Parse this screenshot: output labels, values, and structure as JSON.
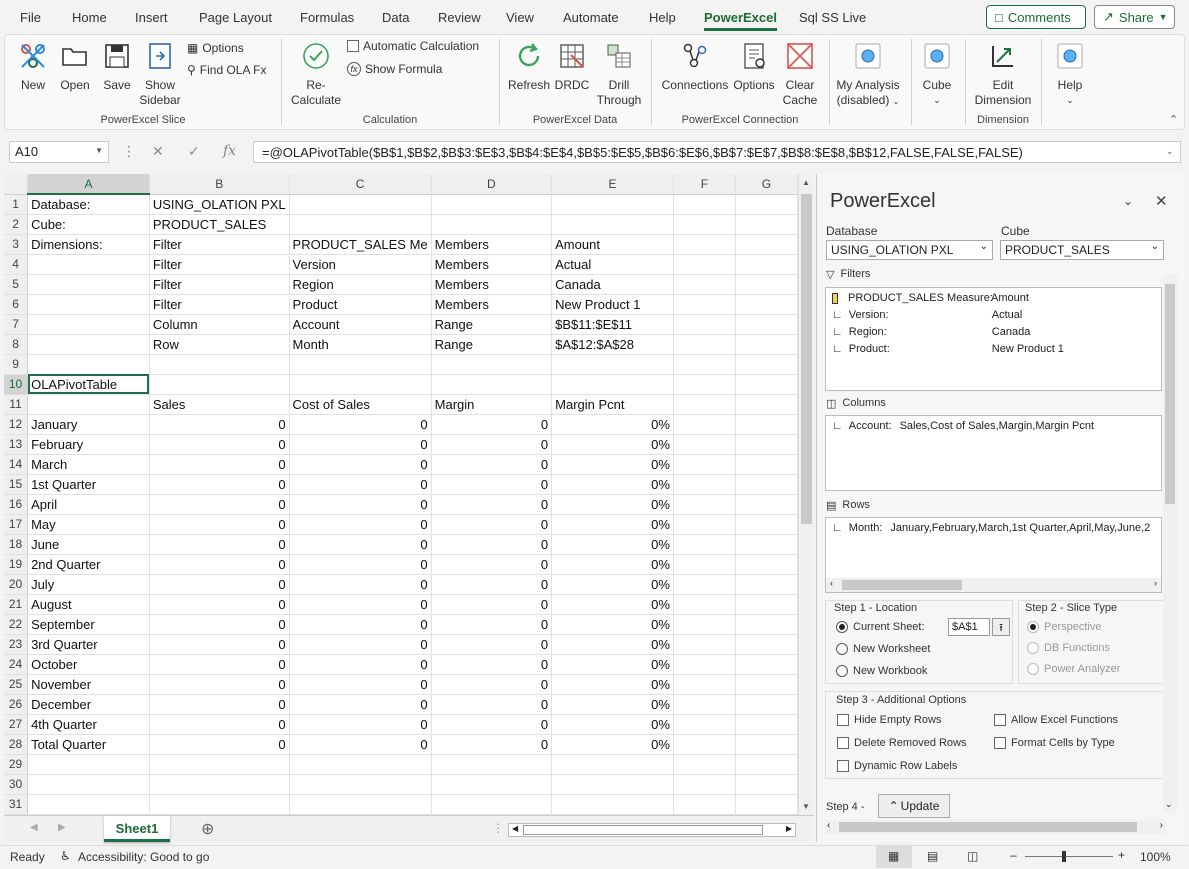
{
  "menu": {
    "tabs": [
      "File",
      "Home",
      "Insert",
      "Page Layout",
      "Formulas",
      "Data",
      "Review",
      "View",
      "Automate",
      "Help",
      "PowerExcel",
      "Sql SS Live"
    ],
    "active": "PowerExcel",
    "comments_label": "Comments",
    "share_label": "Share"
  },
  "ribbon": {
    "slice": {
      "new": "New",
      "open": "Open",
      "save": "Save",
      "show_sidebar_1": "Show",
      "show_sidebar_2": "Sidebar",
      "options": "Options",
      "find_ola_fx": "Find OLA Fx",
      "group": "PowerExcel Slice"
    },
    "calculation": {
      "recalc_1": "Re-",
      "recalc_2": "Calculate",
      "auto_calc": "Automatic Calculation",
      "show_formula": "Show Formula",
      "group": "Calculation"
    },
    "data": {
      "refresh": "Refresh",
      "drdc": "DRDC",
      "drill_1": "Drill",
      "drill_2": "Through",
      "group": "PowerExcel Data"
    },
    "connection": {
      "connections": "Connections",
      "options": "Options",
      "clear_1": "Clear",
      "clear_2": "Cache",
      "group": "PowerExcel Connection"
    },
    "analysis": {
      "label_1": "My Analysis",
      "label_2": "(disabled)"
    },
    "cube": {
      "label": "Cube"
    },
    "dimension": {
      "edit_1": "Edit",
      "edit_2": "Dimension",
      "group": "Dimension"
    },
    "help": {
      "label": "Help"
    }
  },
  "formula_bar": {
    "name_box": "A10",
    "formula": "=@OLAPivotTable($B$1,$B$2,$B$3:$E$3,$B$4:$E$4,$B$5:$E$5,$B$6:$E$6,$B$7:$E$7,$B$8:$E$8,$B$12,FALSE,FALSE,FALSE)"
  },
  "sheet": {
    "columns": [
      "A",
      "B",
      "C",
      "D",
      "E",
      "F",
      "G"
    ],
    "rows": [
      [
        "Database:",
        "USING_OLATION  PXL",
        "",
        "",
        ""
      ],
      [
        "Cube:",
        "PRODUCT_SALES",
        "",
        "",
        ""
      ],
      [
        "Dimensions:",
        "Filter",
        "PRODUCT_SALES Me",
        "Members",
        "Amount"
      ],
      [
        "",
        "Filter",
        "Version",
        "Members",
        "Actual"
      ],
      [
        "",
        "Filter",
        "Region",
        "Members",
        "Canada"
      ],
      [
        "",
        "Filter",
        "Product",
        "Members",
        "New Product 1"
      ],
      [
        "",
        "Column",
        "Account",
        "Range",
        "$B$11:$E$11"
      ],
      [
        "",
        "Row",
        "Month",
        "Range",
        "$A$12:$A$28"
      ],
      [
        "",
        "",
        "",
        "",
        ""
      ],
      [
        "OLAPivotTable",
        "",
        "",
        "",
        ""
      ],
      [
        "",
        "Sales",
        "Cost of Sales",
        "Margin",
        "Margin Pcnt"
      ],
      [
        "January",
        "0",
        "0",
        "0",
        "0%"
      ],
      [
        "February",
        "0",
        "0",
        "0",
        "0%"
      ],
      [
        "March",
        "0",
        "0",
        "0",
        "0%"
      ],
      [
        "1st Quarter",
        "0",
        "0",
        "0",
        "0%"
      ],
      [
        "April",
        "0",
        "0",
        "0",
        "0%"
      ],
      [
        "May",
        "0",
        "0",
        "0",
        "0%"
      ],
      [
        "June",
        "0",
        "0",
        "0",
        "0%"
      ],
      [
        "2nd Quarter",
        "0",
        "0",
        "0",
        "0%"
      ],
      [
        "July",
        "0",
        "0",
        "0",
        "0%"
      ],
      [
        "August",
        "0",
        "0",
        "0",
        "0%"
      ],
      [
        "September",
        "0",
        "0",
        "0",
        "0%"
      ],
      [
        "3rd Quarter",
        "0",
        "0",
        "0",
        "0%"
      ],
      [
        "October",
        "0",
        "0",
        "0",
        "0%"
      ],
      [
        "November",
        "0",
        "0",
        "0",
        "0%"
      ],
      [
        "December",
        "0",
        "0",
        "0",
        "0%"
      ],
      [
        "4th Quarter",
        "0",
        "0",
        "0",
        "0%"
      ],
      [
        "Total Quarter",
        "0",
        "0",
        "0",
        "0%"
      ],
      [
        "",
        "",
        "",
        "",
        ""
      ],
      [
        "",
        "",
        "",
        "",
        ""
      ],
      [
        "",
        "",
        "",
        "",
        ""
      ]
    ],
    "tab": "Sheet1"
  },
  "status": {
    "ready": "Ready",
    "accessibility": "Accessibility: Good to go",
    "zoom": "100%"
  },
  "pane": {
    "title": "PowerExcel",
    "database_label": "Database",
    "database_value": "USING_OLATION  PXL",
    "cube_label": "Cube",
    "cube_value": "PRODUCT_SALES",
    "filters_label": "Filters",
    "filters": [
      {
        "name": "PRODUCT_SALES Measure:",
        "value": "Amount"
      },
      {
        "name": "Version:",
        "value": "Actual"
      },
      {
        "name": "Region:",
        "value": "Canada"
      },
      {
        "name": "Product:",
        "value": "New Product 1"
      }
    ],
    "columns_label": "Columns",
    "columns_entry": {
      "name": "Account:",
      "value": "Sales,Cost of Sales,Margin,Margin Pcnt"
    },
    "rows_label": "Rows",
    "rows_entry": {
      "name": "Month:",
      "value": "January,February,March,1st Quarter,April,May,June,2"
    },
    "step1": {
      "title": "Step 1 - Location",
      "current": "Current Sheet:",
      "cell": "$A$1",
      "new_ws": "New Worksheet",
      "new_wb": "New Workbook"
    },
    "step2": {
      "title": "Step 2 - Slice Type",
      "perspective": "Perspective",
      "db_functions": "DB Functions",
      "power_analyzer": "Power Analyzer"
    },
    "step3": {
      "title": "Step 3 - Additional Options",
      "hide_empty": "Hide Empty Rows",
      "allow_excel": "Allow Excel Functions",
      "delete_removed": "Delete Removed Rows",
      "format_cells": "Format Cells by Type",
      "dynamic_labels": "Dynamic Row Labels"
    },
    "step4": {
      "title": "Step 4 -",
      "update": "Update"
    }
  }
}
